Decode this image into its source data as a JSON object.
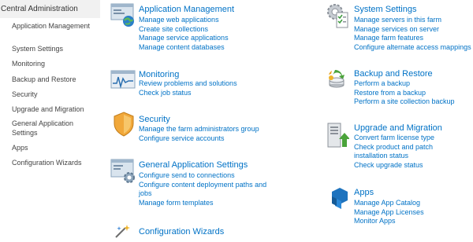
{
  "sidebar": {
    "header": "Central Administration",
    "items": [
      {
        "label": "Application Management"
      },
      {
        "label": "System Settings"
      },
      {
        "label": "Monitoring"
      },
      {
        "label": "Backup and Restore"
      },
      {
        "label": "Security"
      },
      {
        "label": "Upgrade and Migration"
      },
      {
        "label": "General Application Settings"
      },
      {
        "label": "Apps"
      },
      {
        "label": "Configuration Wizards"
      }
    ]
  },
  "sections": {
    "application_management": {
      "title": "Application Management",
      "icon": "application-management-icon",
      "links": [
        "Manage web applications",
        "Create site collections",
        "Manage service applications",
        "Manage content databases"
      ]
    },
    "system_settings": {
      "title": "System Settings",
      "icon": "system-settings-icon",
      "links": [
        "Manage servers in this farm",
        "Manage services on server",
        "Manage farm features",
        "Configure alternate access mappings"
      ]
    },
    "monitoring": {
      "title": "Monitoring",
      "icon": "monitoring-icon",
      "links": [
        "Review problems and solutions",
        "Check job status"
      ]
    },
    "backup_restore": {
      "title": "Backup and Restore",
      "icon": "backup-restore-icon",
      "links": [
        "Perform a backup",
        "Restore from a backup",
        "Perform a site collection backup"
      ]
    },
    "security": {
      "title": "Security",
      "icon": "shield-icon",
      "links": [
        "Manage the farm administrators group",
        "Configure service accounts"
      ]
    },
    "upgrade_migration": {
      "title": "Upgrade and Migration",
      "icon": "upgrade-server-icon",
      "links": [
        "Convert farm license type",
        "Check product and patch installation status",
        "Check upgrade status"
      ]
    },
    "general_settings": {
      "title": "General Application Settings",
      "icon": "general-settings-icon",
      "links": [
        "Configure send to connections",
        "Configure content deployment paths and jobs",
        "Manage form templates"
      ]
    },
    "apps": {
      "title": "Apps",
      "icon": "apps-icon",
      "links": [
        "Manage App Catalog",
        "Manage App Licenses",
        "Monitor Apps"
      ]
    },
    "config_wizards": {
      "title": "Configuration Wizards",
      "icon": "wizard-icon",
      "links": []
    }
  },
  "colors": {
    "link": "#0072c6",
    "nav_header_bg": "#f1f1f1",
    "nav_text": "#444444"
  }
}
